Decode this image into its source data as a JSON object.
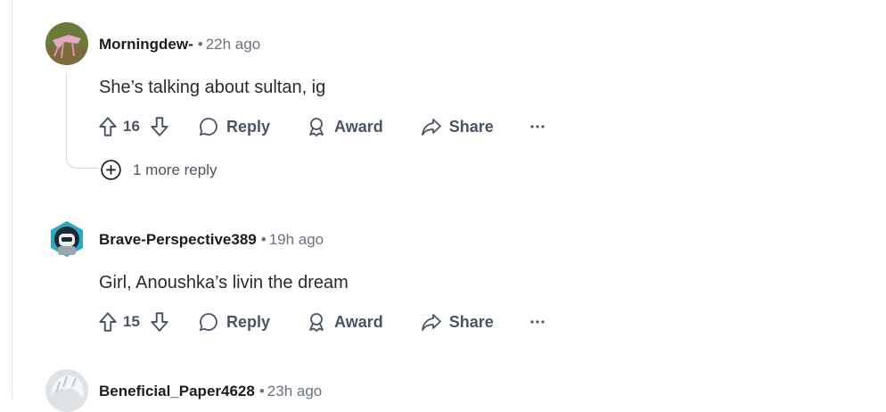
{
  "comments": [
    {
      "author": "Morningdew-",
      "time": "22h ago",
      "body": "She’s talking about sultan, ig",
      "votes": "16",
      "reply_label": "Reply",
      "award_label": "Award",
      "share_label": "Share",
      "more_replies_label": "1 more reply"
    },
    {
      "author": "Brave-Perspective389",
      "time": "19h ago",
      "body": "Girl, Anoushka’s livin the dream",
      "votes": "15",
      "reply_label": "Reply",
      "award_label": "Award",
      "share_label": "Share"
    },
    {
      "author": "Beneficial_Paper4628",
      "time": "23h ago"
    }
  ],
  "separator": "•"
}
